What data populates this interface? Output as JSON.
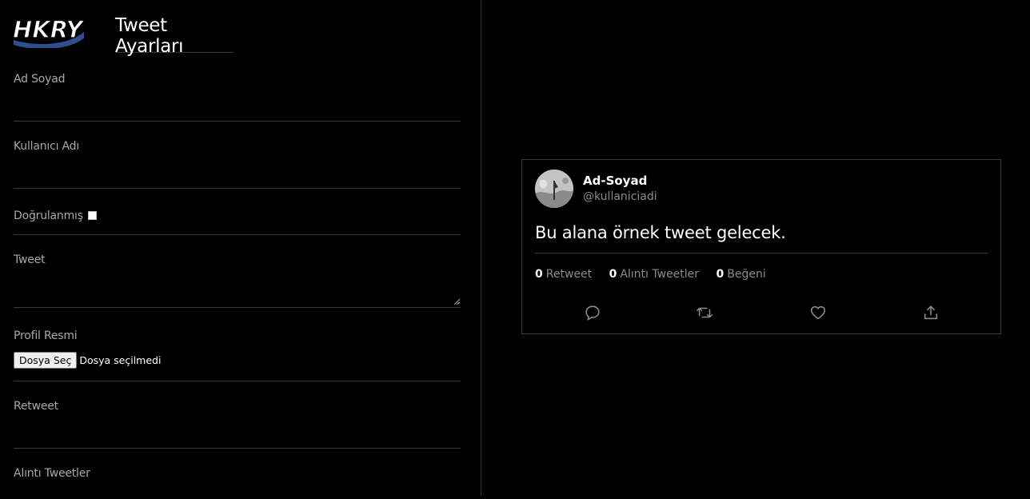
{
  "app": {
    "logo_text": "HKRY",
    "page_title": "Tweet Ayarları"
  },
  "form": {
    "name_label": "Ad Soyad",
    "name_value": "",
    "username_label": "Kullanıcı Adı",
    "username_value": "",
    "verified_label": "Doğrulanmış",
    "verified_checked": false,
    "tweet_label": "Tweet",
    "tweet_value": "",
    "avatar_label": "Profil Resmi",
    "file_button_label": "Dosya Seç",
    "file_status": "Dosya seçilmedi",
    "retweet_label": "Retweet",
    "retweet_value": "",
    "quote_label": "Alıntı Tweetler"
  },
  "tweet": {
    "name": "Ad-Soyad",
    "handle": "@kullaniciadi",
    "text": "Bu alana örnek tweet gelecek.",
    "retweet_count": "0",
    "retweet_label": "Retweet",
    "quote_count": "0",
    "quote_label": "Alıntı Tweetler",
    "like_count": "0",
    "like_label": "Beğeni",
    "actions": [
      "reply-icon",
      "retweet-icon",
      "like-icon",
      "share-icon"
    ]
  },
  "colors": {
    "background": "#000000",
    "label": "#a8a8a8",
    "muted": "#8b8b8b",
    "border": "#3a3a3a"
  }
}
